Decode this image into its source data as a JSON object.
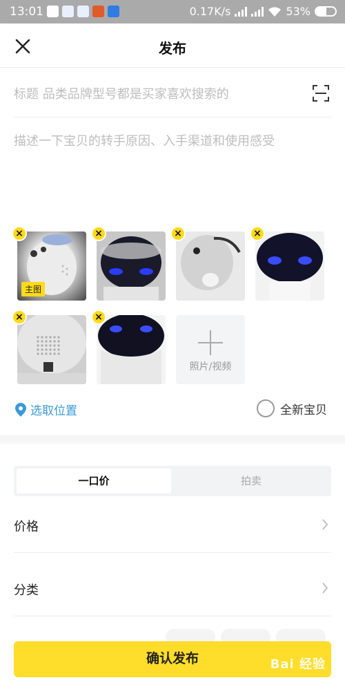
{
  "status_bar": {
    "time": "13:01",
    "network_speed": "0.17K/s",
    "battery": "53%",
    "battery_level": 0.53,
    "notification_icons": [
      "app-notification-icon",
      "app-notification-icon",
      "app-notification-icon",
      "news-icon",
      "chart-icon"
    ]
  },
  "header": {
    "title": "发布",
    "close_icon": "close-icon"
  },
  "form": {
    "title_placeholder": "标题 品类品牌型号都是买家喜欢搜索的",
    "description_placeholder": "描述一下宝贝的转手原因、入手渠道和使用感受",
    "main_image_tag": "主图",
    "add_media_label": "照片/视频",
    "delete_badge": "×",
    "location_label": "选取位置",
    "new_item_label": "全新宝贝"
  },
  "photos": [
    {
      "main": true
    },
    {
      "main": false
    },
    {
      "main": false
    },
    {
      "main": false
    },
    {
      "main": false
    },
    {
      "main": false
    }
  ],
  "pricing_tabs": {
    "fixed": "一口价",
    "auction": "拍卖",
    "selected": "fixed"
  },
  "rows": {
    "price": "价格",
    "category": "分类"
  },
  "confirm_button": "确认发布",
  "watermark": "Bai 经验",
  "colors": {
    "accent": "#ffdd2a",
    "link": "#3a9ad9",
    "placeholder": "#bdbdbd"
  }
}
